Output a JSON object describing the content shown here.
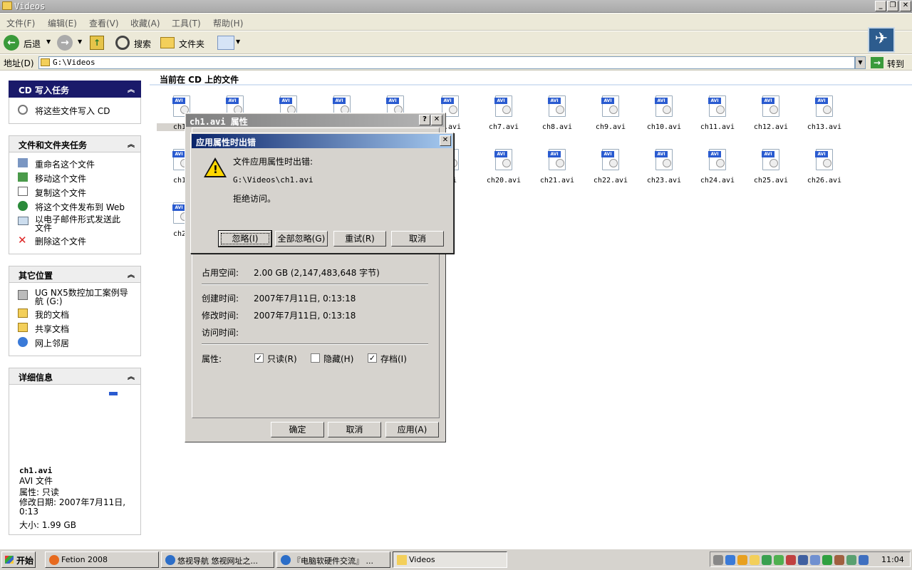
{
  "window": {
    "title": "Videos"
  },
  "menu": [
    "文件(F)",
    "编辑(E)",
    "查看(V)",
    "收藏(A)",
    "工具(T)",
    "帮助(H)"
  ],
  "toolbar": {
    "back": "后退",
    "search": "搜索",
    "folders": "文件夹"
  },
  "address": {
    "label": "地址(D)",
    "value": "G:\\Videos",
    "go": "转到"
  },
  "cd_tasks": {
    "title": "CD 写入任务",
    "items": [
      "将这些文件写入 CD"
    ]
  },
  "file_tasks": {
    "title": "文件和文件夹任务",
    "items": [
      "重命名这个文件",
      "移动这个文件",
      "复制这个文件",
      "将这个文件发布到 Web",
      "以电子邮件形式发送此文件",
      "删除这个文件"
    ]
  },
  "other_places": {
    "title": "其它位置",
    "items": [
      "UG NX5数控加工案例导航 (G:)",
      "我的文档",
      "共享文档",
      "网上邻居"
    ]
  },
  "details": {
    "title": "详细信息",
    "name": "ch1.avi",
    "type": "AVI 文件",
    "attr": "属性: 只读",
    "modified": "修改日期: 2007年7月11日, 0:13",
    "size": "大小: 1.99 GB"
  },
  "main": {
    "heading": "当前在 CD 上的文件",
    "row1": [
      "ch1.",
      "",
      "",
      "",
      "",
      "5.avi",
      "ch7.avi",
      "ch8.avi",
      "ch9.avi",
      "ch10.avi",
      "ch11.avi",
      "ch12.avi",
      "ch13.avi"
    ],
    "row2": [
      "ch14",
      "",
      "",
      "",
      "",
      "avi",
      "ch20.avi",
      "ch21.avi",
      "ch22.avi",
      "ch23.avi",
      "ch24.avi",
      "ch25.avi",
      "ch26.avi"
    ],
    "row3": [
      "ch27"
    ],
    "badge": "AVI"
  },
  "prop_dialog": {
    "title": "ch1.avi 属性",
    "size_on_disk_label": "占用空间:",
    "size_on_disk": "2.00 GB (2,147,483,648 字节)",
    "created_label": "创建时间:",
    "created": "2007年7月11日, 0:13:18",
    "modified_label": "修改时间:",
    "modified": "2007年7月11日, 0:13:18",
    "accessed_label": "访问时间:",
    "attr_label": "属性:",
    "readonly": "只读(R)",
    "hidden": "隐藏(H)",
    "archive": "存档(I)",
    "ok": "确定",
    "cancel": "取消",
    "apply": "应用(A)"
  },
  "error_dialog": {
    "title": "应用属性时出错",
    "message": "文件应用属性时出错:",
    "path": "G:\\Videos\\ch1.avi",
    "reason": "拒绝访问。",
    "ignore": "忽略(I)",
    "ignore_all": "全部忽略(G)",
    "retry": "重试(R)",
    "cancel": "取消"
  },
  "taskbar": {
    "start": "开始",
    "items": [
      "Fetion 2008",
      "悠视导航 悠视网址之...",
      "『电脑软硬件交流』 ...",
      "Videos"
    ],
    "clock": "11:04"
  }
}
